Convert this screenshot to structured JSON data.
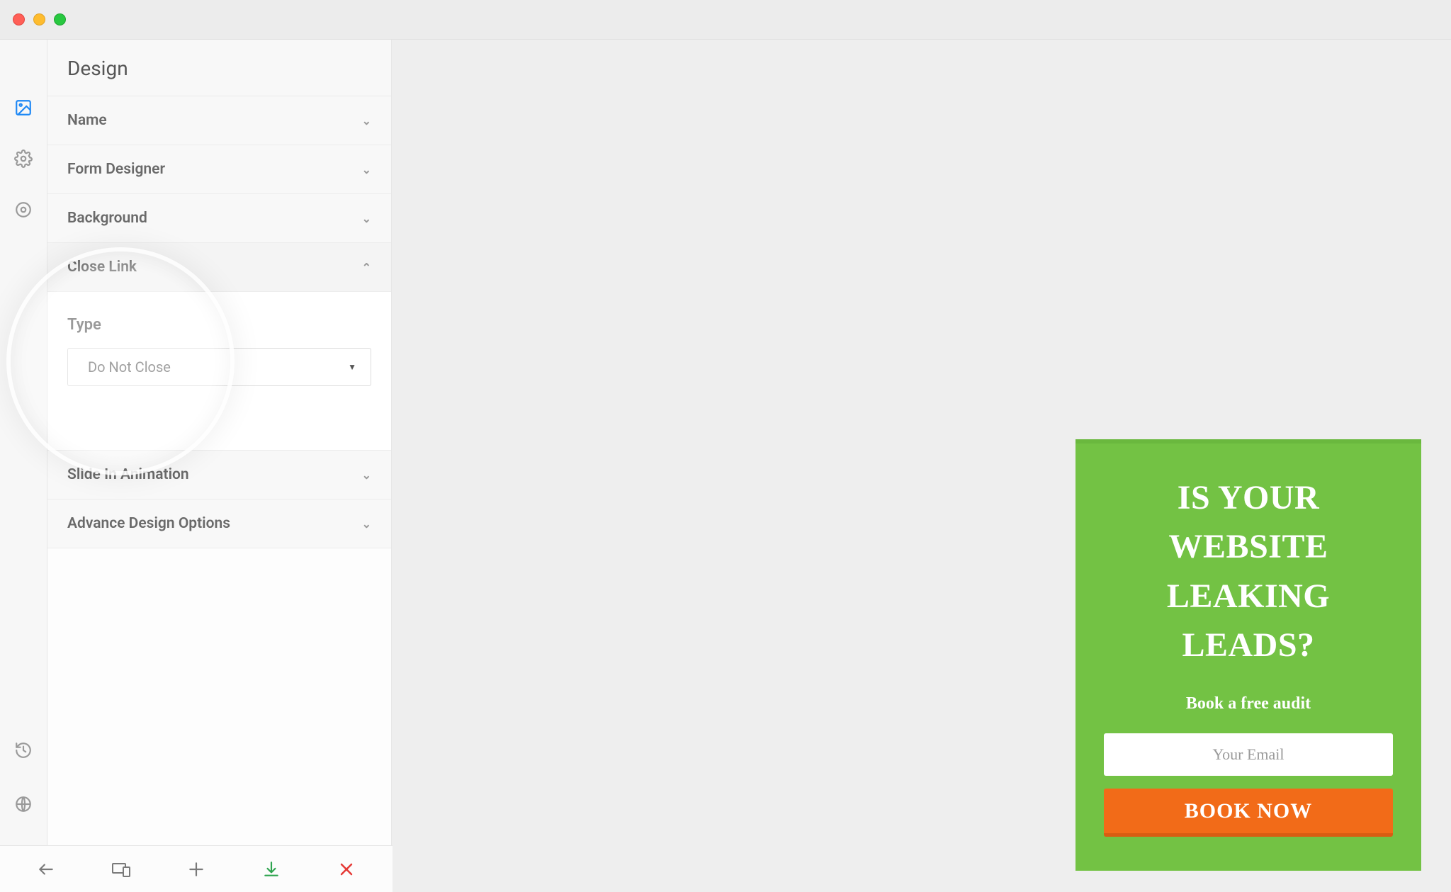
{
  "sidebar": {
    "title": "Design",
    "sections": {
      "name": "Name",
      "form_designer": "Form Designer",
      "background": "Background",
      "close_link": "Close Link",
      "slide_in": "Slide In Animation",
      "advanced": "Advance Design Options"
    },
    "close_link_panel": {
      "type_label": "Type",
      "type_value": "Do Not Close"
    }
  },
  "popup": {
    "title": "IS YOUR WEBSITE LEAKING LEADS?",
    "subtitle": "Book a free audit",
    "email_placeholder": "Your Email",
    "button": "BOOK NOW"
  },
  "colors": {
    "popup_bg": "#73c244",
    "popup_btn": "#f26b18"
  }
}
